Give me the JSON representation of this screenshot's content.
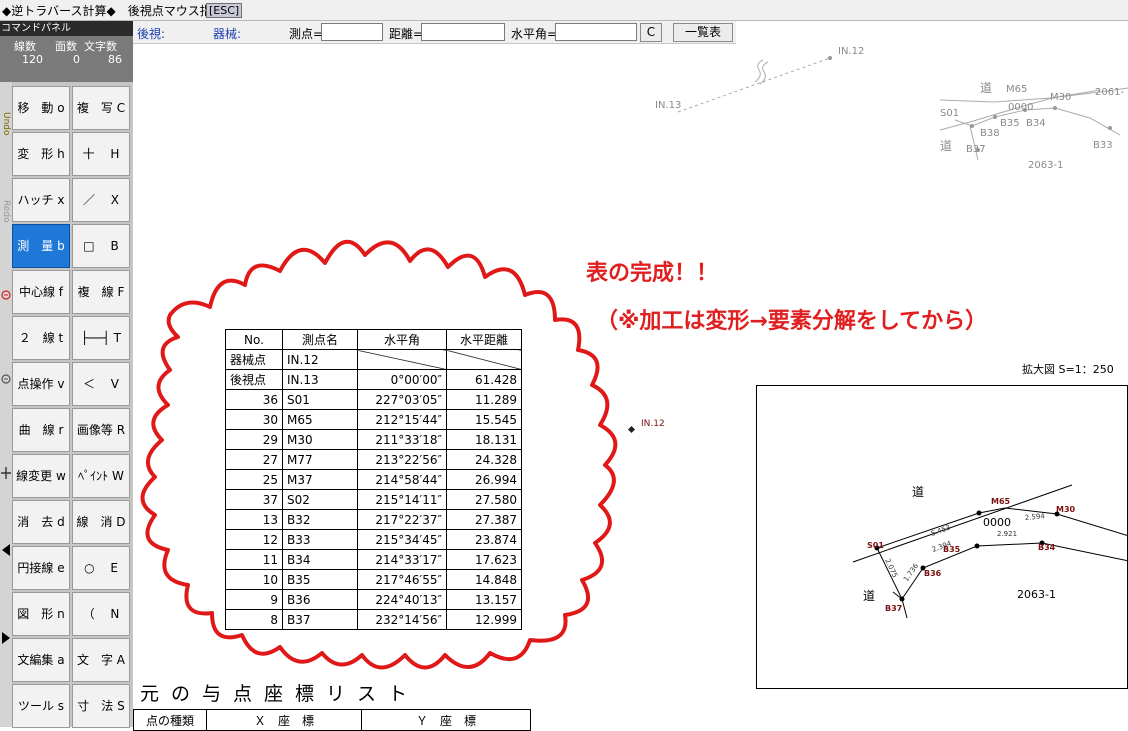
{
  "titlebar": {
    "title": "◆逆トラバース計算◆　後視点マウス指示",
    "esc": "[ESC]"
  },
  "toolbar": {
    "backsight_label": "後視:",
    "instrument_label": "器械:",
    "station_label": "測点=",
    "distance_label": "距離=",
    "hangle_label": "水平角=",
    "c_button": "C",
    "list_button": "一覧表"
  },
  "panel": {
    "title": "コマンドパネル",
    "stats_headers": [
      "線数",
      "面数",
      "文字数"
    ],
    "stats_values": [
      "120",
      "0",
      "86"
    ],
    "side_labels": [
      "Undo",
      "Redo"
    ],
    "buttons": [
      [
        "移　動 o",
        "複　写 C"
      ],
      [
        "変　形 h",
        "十　 H"
      ],
      [
        "ハッチ x",
        "／　 X"
      ],
      [
        "測　量 b",
        "□　 B"
      ],
      [
        "中心線 f",
        "複　線 F"
      ],
      [
        "２　線 t",
        "├──┤ T"
      ],
      [
        "点操作 v",
        "＜　 V"
      ],
      [
        "曲　線 r",
        "画像等 R"
      ],
      [
        "線変更 w",
        "ﾍﾟｲﾝﾄ W"
      ],
      [
        "消　去 d",
        "線　消 D"
      ],
      [
        "円接線 e",
        "○　 E"
      ],
      [
        "図　形 n",
        "（　 N"
      ],
      [
        "文編集 a",
        "文　字 A"
      ],
      [
        "ツール s",
        "寸　法 S"
      ]
    ]
  },
  "canvas": {
    "annotation_line1": "表の完成！！",
    "annotation_line2": "（※加工は変形→要素分解をしてから）",
    "in12_label": "IN.12",
    "zoom_scale": "拡大図 S=1：250",
    "top_labels": {
      "in12": "IN.12",
      "in13": "IN.13",
      "road": "道",
      "m65": "M65",
      "m30": "M30",
      "s01": "S01",
      "b38": "B38",
      "b35": "B35",
      "b34": "B34",
      "b33": "B33",
      "b37": "B37",
      "code0000": "0000",
      "p2061": "2061-",
      "p2063": "2063-1"
    },
    "zoom_labels": {
      "road_upper": "道",
      "road_lower": "道",
      "m65": "M65",
      "m30": "M30",
      "s01": "S01",
      "b35": "B35",
      "b34": "B34",
      "b36": "B36",
      "b37": "B37",
      "code0000": "0000",
      "parcel": "2063-1",
      "d1": "5.453",
      "d2": "2.594",
      "d3": "2.394",
      "d4": "2.921",
      "d5": "2.075",
      "d6": "1.736"
    }
  },
  "survey_table": {
    "headers": [
      "No.",
      "測点名",
      "水平角",
      "水平距離"
    ],
    "rows": [
      [
        "器械点",
        "IN.12",
        "",
        ""
      ],
      [
        "後視点",
        "IN.13",
        "0°00′00″",
        "61.428"
      ],
      [
        "36",
        "S01",
        "227°03′05″",
        "11.289"
      ],
      [
        "30",
        "M65",
        "212°15′44″",
        "15.545"
      ],
      [
        "29",
        "M30",
        "211°33′18″",
        "18.131"
      ],
      [
        "27",
        "M77",
        "213°22′56″",
        "24.328"
      ],
      [
        "25",
        "M37",
        "214°58′44″",
        "26.994"
      ],
      [
        "37",
        "S02",
        "215°14′11″",
        "27.580"
      ],
      [
        "13",
        "B32",
        "217°22′37″",
        "27.387"
      ],
      [
        "12",
        "B33",
        "215°34′45″",
        "23.874"
      ],
      [
        "11",
        "B34",
        "214°33′17″",
        "17.623"
      ],
      [
        "10",
        "B35",
        "217°46′55″",
        "14.848"
      ],
      [
        "9",
        "B36",
        "224°40′13″",
        "13.157"
      ],
      [
        "8",
        "B37",
        "232°14′56″",
        "12.999"
      ]
    ]
  },
  "bottom_list": {
    "title": "元の与点座標リスト",
    "headers": [
      "点の種類",
      "Ｘ　座　標",
      "Ｙ　座　標"
    ]
  }
}
